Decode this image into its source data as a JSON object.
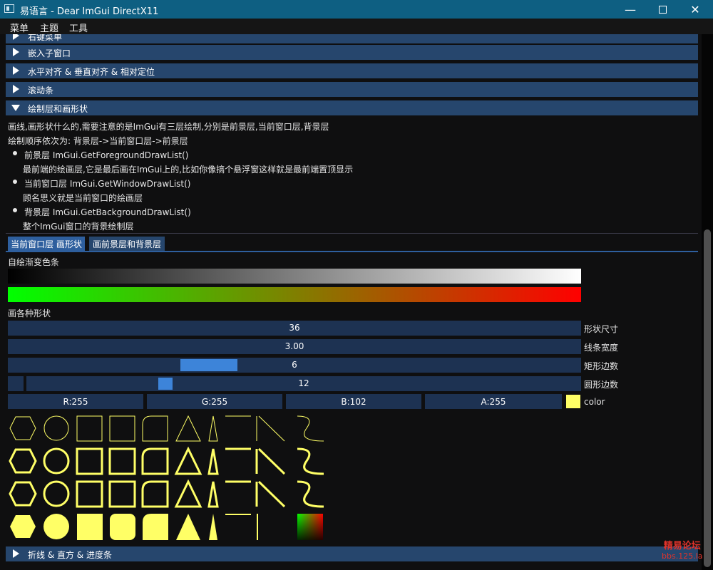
{
  "window": {
    "title": "易语言 - Dear ImGui DirectX11",
    "minimize_icon": "minimize-icon",
    "maximize_icon": "maximize-icon",
    "close_icon": "close-icon"
  },
  "menu": {
    "items": [
      "菜单",
      "主题",
      "工具"
    ]
  },
  "sections_collapsed_top": [
    {
      "label": "右键菜单"
    },
    {
      "label": "嵌入子窗口"
    },
    {
      "label": "水平对齐 & 垂直对齐 & 相对定位"
    },
    {
      "label": "滚动条"
    }
  ],
  "draw_section": {
    "label": "绘制层和画形状",
    "intro1": "画线,画形状什么的,需要注意的是ImGui有三层绘制,分别是前景层,当前窗口层,背景层",
    "intro2": "绘制顺序依次为: 背景层->当前窗口层->前景层",
    "layers": [
      {
        "title": "前景层 ImGui.GetForegroundDrawList()",
        "desc": "最前端的绘画层,它是最后画在ImGui上的,比如你像搞个悬浮窗这样就是最前端置顶显示"
      },
      {
        "title": "当前窗口层 ImGui.GetWindowDrawList()",
        "desc": "顾名思义就是当前窗口的绘画层"
      },
      {
        "title": "背景层 ImGui.GetBackgroundDrawList()",
        "desc": "整个ImGui窗口的背景绘制层"
      }
    ],
    "tabs": [
      "当前窗口层 画形状",
      "画前景层和背景层"
    ],
    "active_tab": 0,
    "gradient_label": "自绘渐变色条",
    "shapes_label": "画各种形状",
    "sliders": [
      {
        "value": "36",
        "label": "形状尺寸",
        "fraction": null
      },
      {
        "value": "3.00",
        "label": "线条宽度",
        "fraction": null
      },
      {
        "value": "6",
        "label": "矩形边数",
        "fraction": 0.3
      },
      {
        "value": "12",
        "label": "圆形边数",
        "fraction": 0.25
      }
    ],
    "color": {
      "r": "R:255",
      "g": "G:255",
      "b": "B:102",
      "a": "A:255",
      "label": "color",
      "swatch": "#ffff66"
    }
  },
  "section_bottom": {
    "label": "折线 & 直方 & 进度条"
  },
  "theme": {
    "accent": "#26466d",
    "shape_color": "#ffff66",
    "gradient_bw": [
      "#000000",
      "#ffffff"
    ],
    "gradient_gr": [
      "#00ff00",
      "#ff0000"
    ]
  },
  "watermark": {
    "line1": "精易论坛",
    "line2": "bbs.125.la"
  }
}
